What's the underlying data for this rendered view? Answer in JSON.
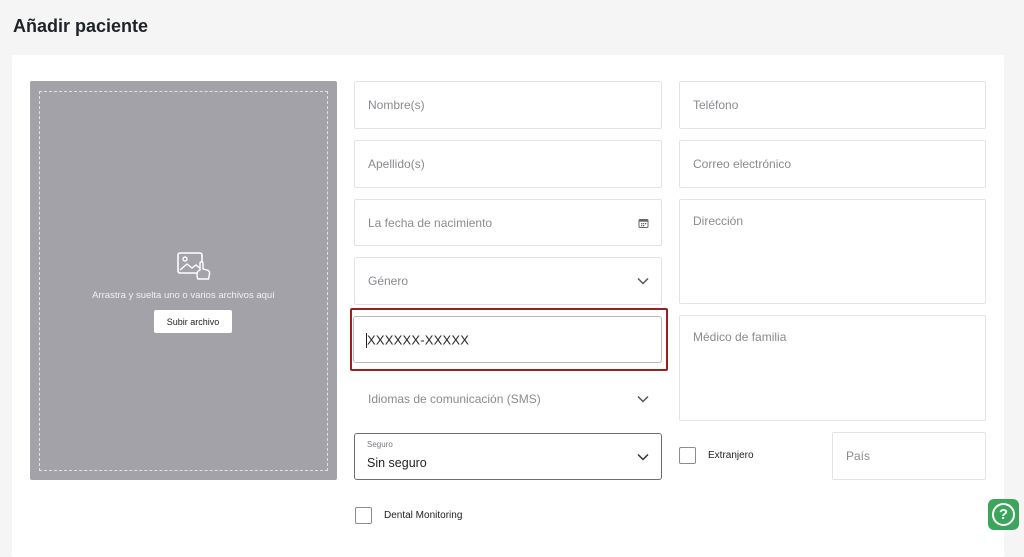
{
  "page": {
    "title": "Añadir paciente"
  },
  "dropzone": {
    "instruction": "Arrastra y suelta uno o varios archivos aquí",
    "upload_label": "Subir archivo",
    "icon": "image-upload-icon"
  },
  "form": {
    "nombre_placeholder": "Nombre(s)",
    "apellido_placeholder": "Apellido(s)",
    "fecha_placeholder": "La fecha de nacimiento",
    "genero_placeholder": "Género",
    "telefono_value": "XXXXXX-XXXXX",
    "idiomas_placeholder": "Idiomas de comunicación (SMS)",
    "seguro_label": "Seguro",
    "seguro_value": "Sin seguro",
    "dental_label": "Dental Monitoring",
    "telefono_placeholder": "Teléfono",
    "correo_placeholder": "Correo electrónico",
    "direccion_placeholder": "Dirección",
    "medico_placeholder": "Médico de familia",
    "extranjero_label": "Extranjero",
    "pais_placeholder": "País"
  },
  "help": {
    "label": "?"
  },
  "colors": {
    "dropzone_bg": "#a2a2a8",
    "highlight": "#9b2020",
    "help_green": "#3ba55c"
  }
}
